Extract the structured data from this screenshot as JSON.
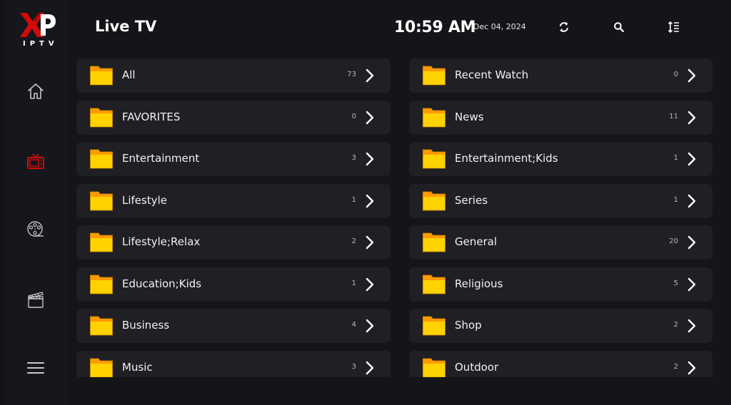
{
  "app": {
    "logo_text": "XP",
    "logo_subtitle": "IPTV"
  },
  "sidebar": {
    "items": [
      {
        "name": "home",
        "icon": "home-icon",
        "active": false
      },
      {
        "name": "live-tv",
        "icon": "tv-icon",
        "active": true
      },
      {
        "name": "movies",
        "icon": "film-reel-icon",
        "active": false
      },
      {
        "name": "series",
        "icon": "clapperboard-icon",
        "active": false
      },
      {
        "name": "menu",
        "icon": "hamburger-menu-icon",
        "active": false
      }
    ]
  },
  "header": {
    "title": "Live TV",
    "time": "10:59 AM",
    "date": "Dec 04, 2024",
    "buttons": [
      {
        "name": "refresh",
        "icon": "refresh-icon"
      },
      {
        "name": "search",
        "icon": "search-icon"
      },
      {
        "name": "sort",
        "icon": "sort-icon"
      }
    ]
  },
  "colors": {
    "accent": "#d40a0a",
    "folder_body": "#ffd200",
    "folder_tab": "#ff9a00",
    "row_bg": "#1f1f24",
    "page_bg": "#141519"
  },
  "categories": {
    "left": [
      {
        "label": "All",
        "count": "73"
      },
      {
        "label": "FAVORITES",
        "count": "0"
      },
      {
        "label": "Entertainment",
        "count": "3"
      },
      {
        "label": "Lifestyle",
        "count": "1"
      },
      {
        "label": "Lifestyle;Relax",
        "count": "2"
      },
      {
        "label": "Education;Kids",
        "count": "1"
      },
      {
        "label": "Business",
        "count": "4"
      },
      {
        "label": "Music",
        "count": "3"
      }
    ],
    "right": [
      {
        "label": "Recent Watch",
        "count": "0"
      },
      {
        "label": "News",
        "count": "11"
      },
      {
        "label": "Entertainment;Kids",
        "count": "1"
      },
      {
        "label": "Series",
        "count": "1"
      },
      {
        "label": "General",
        "count": "20"
      },
      {
        "label": "Religious",
        "count": "5"
      },
      {
        "label": "Shop",
        "count": "2"
      },
      {
        "label": "Outdoor",
        "count": "2"
      }
    ]
  }
}
